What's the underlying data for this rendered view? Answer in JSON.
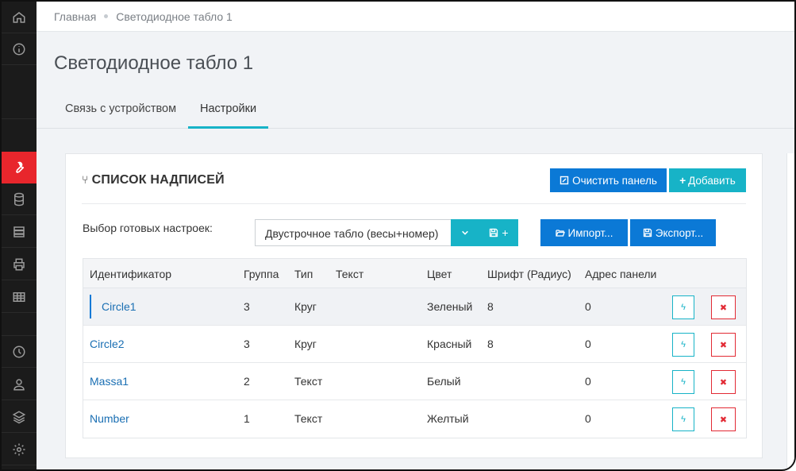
{
  "breadcrumb": {
    "home": "Главная",
    "current": "Светодиодное табло 1"
  },
  "page": {
    "title": "Светодиодное табло 1"
  },
  "tabs": [
    {
      "label": "Связь с устройством",
      "active": false
    },
    {
      "label": "Настройки",
      "active": true
    }
  ],
  "card": {
    "title": "СПИСОК НАДПИСЕЙ",
    "clear_label": "Очистить панель",
    "add_label": "Добавить",
    "presets_label": "Выбор готовых настроек:",
    "preset_value": "Двустрочное табло (весы+номер)",
    "save_plus": "+",
    "import_label": "Импорт...",
    "export_label": "Экспорт..."
  },
  "table": {
    "headers": [
      "Идентификатор",
      "Группа",
      "Тип",
      "Текст",
      "Цвет",
      "Шрифт (Радиус)",
      "Адрес панели"
    ],
    "rows": [
      {
        "id": "Circle1",
        "group": "3",
        "type": "Круг",
        "text": "",
        "color": "Зеленый",
        "font": "8",
        "address": "0"
      },
      {
        "id": "Circle2",
        "group": "3",
        "type": "Круг",
        "text": "",
        "color": "Красный",
        "font": "8",
        "address": "0"
      },
      {
        "id": "Massa1",
        "group": "2",
        "type": "Текст",
        "text": "",
        "color": "Белый",
        "font": "",
        "address": "0"
      },
      {
        "id": "Number",
        "group": "1",
        "type": "Текст",
        "text": "",
        "color": "Желтый",
        "font": "",
        "address": "0"
      }
    ]
  },
  "colors": {
    "accent_red": "#e8262c",
    "primary_blue": "#0b79d6",
    "cyan": "#17b3c7",
    "sidebar": "#1b1b1b"
  },
  "sidebar_icons": [
    "home-icon",
    "info-icon",
    "wrench-icon",
    "database-icon",
    "server-icon",
    "printer-icon",
    "table-icon",
    "clock-icon",
    "users-icon",
    "layers-icon",
    "gear-icon"
  ]
}
